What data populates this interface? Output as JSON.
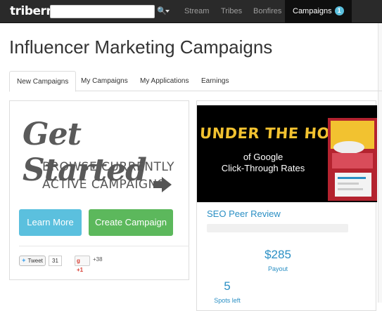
{
  "nav": {
    "logo": "triberr",
    "search": {
      "value": "",
      "placeholder": ""
    },
    "items": [
      {
        "label": "Stream"
      },
      {
        "label": "Tribes"
      },
      {
        "label": "Bonfires"
      }
    ],
    "active": {
      "label": "Campaigns",
      "badge": "1"
    }
  },
  "page": {
    "title": "Influencer Marketing Campaigns"
  },
  "tabs": [
    {
      "label": "New Campaigns"
    },
    {
      "label": "My Campaigns"
    },
    {
      "label": "My Applications"
    },
    {
      "label": "Earnings"
    }
  ],
  "promo": {
    "heading": "Get Started",
    "line1": "BROWSE CURRENTLY",
    "line2": "ACTIVE CAMPAIGNS",
    "learn_more": "Learn More",
    "create": "Create Campaign",
    "tweet_label": "Tweet",
    "tweet_count": "31",
    "gplus_label": "+1",
    "gplus_count": "+38"
  },
  "campaign": {
    "hero_title": "UNDER THE HOOD",
    "hero_sub1": "of Google",
    "hero_sub2": "Click-Through Rates",
    "title": "SEO Peer Review",
    "payout": "$285",
    "payout_label": "Payout",
    "spots": "5",
    "spots_label": "Spots left"
  },
  "colors": {
    "nav_bg": "#2a2a2a",
    "info": "#5bc0de",
    "success": "#5cb85c",
    "link": "#2a8fc4",
    "hero_accent": "#f2c230"
  }
}
